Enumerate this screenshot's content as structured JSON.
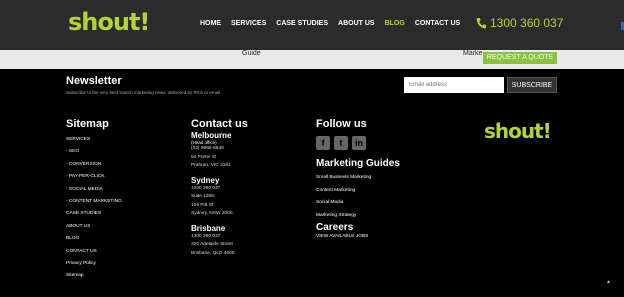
{
  "header": {
    "logo": "shout!",
    "nav": [
      "HOME",
      "SERVICES",
      "CASE STUDIES",
      "ABOUT US",
      "BLOG",
      "CONTACT US"
    ],
    "active_nav": "BLOG",
    "phone": "1300 360 037"
  },
  "strip": {
    "guide_text": "Guide",
    "mark_text": "Marke",
    "quote_button": "REQUEST A QUOTE"
  },
  "newsletter": {
    "title": "Newsletter",
    "subtitle": "Subscribe to the very best search marketing news, delivered by RSS or email.",
    "email_placeholder": "Email address",
    "subscribe_label": "SUBSCRIBE"
  },
  "sitemap": {
    "title": "Sitemap",
    "items": [
      "SERVICES",
      "- SEO",
      "- CONVERSION",
      "- PAY-PER-CLICK",
      "- SOCIAL MEDIA",
      "- CONTENT MARKETING",
      "CASE STUDIES",
      "ABOUT US",
      "BLOG",
      "CONTACT US",
      "Privacy Policy",
      "Sitemap"
    ]
  },
  "contact": {
    "title": "Contact us",
    "melbourne": {
      "city": "Melbourne",
      "note": "(Head office)",
      "lines": [
        "(03) 9866-8648",
        "54 Porter st",
        "Prahran, VIC 3181"
      ]
    },
    "sydney": {
      "city": "Sydney",
      "lines": [
        "1300 360 037",
        "Suite 1308,",
        "109 Pitt St",
        "Sydney, NSW 2000."
      ]
    },
    "brisbane": {
      "city": "Brisbane",
      "lines": [
        "1300 360 037",
        "320 Adelaide Street",
        "Brisbane, QLD 4000."
      ]
    }
  },
  "follow": {
    "title": "Follow us",
    "icons": [
      "facebook-icon",
      "twitter-icon",
      "linkedin-icon"
    ]
  },
  "guides": {
    "title": "Marketing Guides",
    "items": [
      "Small Business Marketing",
      "Content Marketing",
      "Social Media",
      "Marketing Strategy"
    ]
  },
  "careers": {
    "title": "Careers",
    "link": "VIEW AVAILABLE JOBS"
  },
  "footer_logo": "shout!",
  "colors": {
    "accent": "#b5d334",
    "header_bg": "#2b2b2b",
    "quote_btn": "#8ac23f"
  }
}
